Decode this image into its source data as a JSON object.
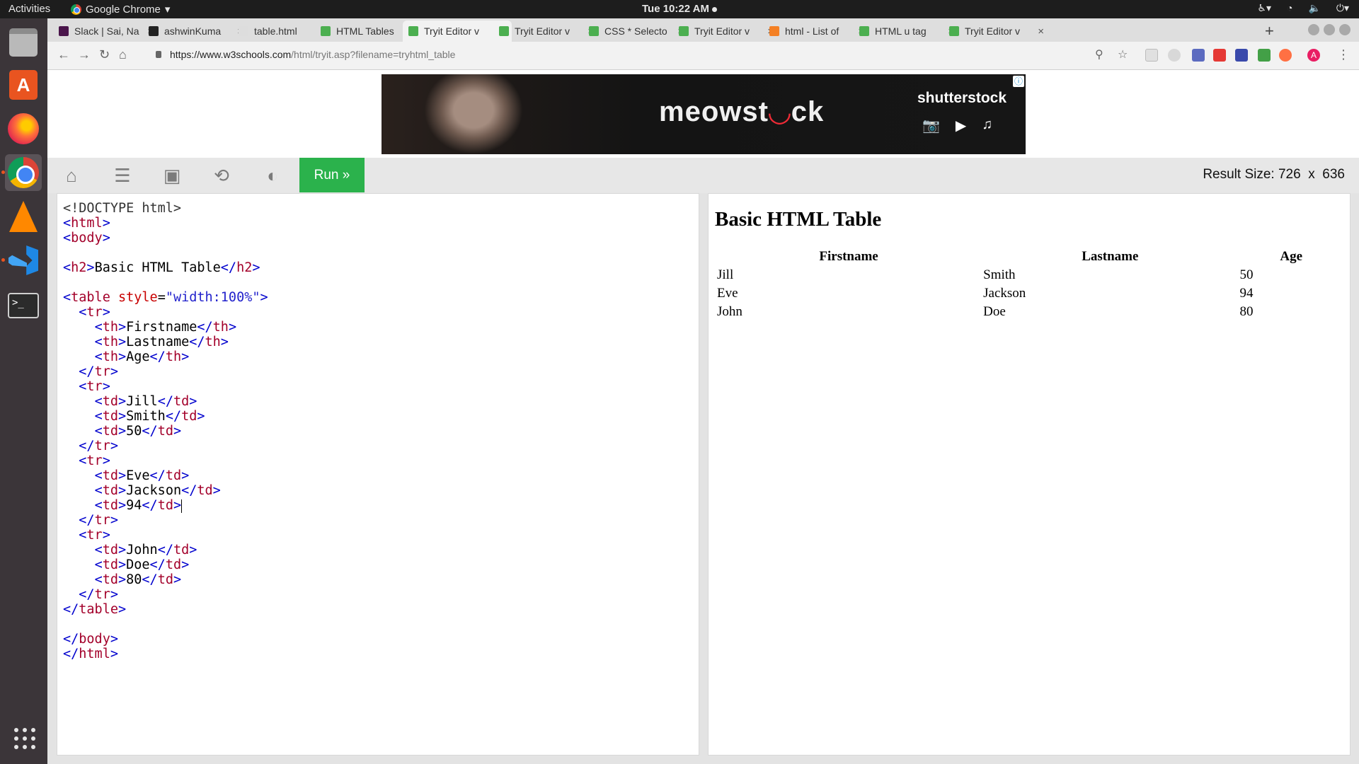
{
  "system": {
    "activities": "Activities",
    "app_menu": "Google Chrome",
    "clock": "Tue 10:22 AM"
  },
  "browser": {
    "tabs": [
      {
        "title": "Slack | Sai, Na",
        "favicon": "slack-icon",
        "color": "#4a154b"
      },
      {
        "title": "ashwinKuma",
        "favicon": "github-icon",
        "color": "#222222"
      },
      {
        "title": "table.html",
        "favicon": "file-icon",
        "color": "#dddddd"
      },
      {
        "title": "HTML Tables",
        "favicon": "w3schools-icon",
        "color": "#4caf50"
      },
      {
        "title": "Tryit Editor v",
        "favicon": "w3schools-icon",
        "color": "#4caf50",
        "active": true
      },
      {
        "title": "Tryit Editor v",
        "favicon": "w3schools-icon",
        "color": "#4caf50"
      },
      {
        "title": "CSS * Selecto",
        "favicon": "w3schools-icon",
        "color": "#4caf50"
      },
      {
        "title": "Tryit Editor v",
        "favicon": "w3schools-icon",
        "color": "#4caf50"
      },
      {
        "title": "html - List of",
        "favicon": "stackoverflow-icon",
        "color": "#f48024"
      },
      {
        "title": "HTML u tag",
        "favicon": "w3schools-icon",
        "color": "#4caf50"
      },
      {
        "title": "Tryit Editor v",
        "favicon": "w3schools-icon",
        "color": "#4caf50"
      }
    ],
    "url_host": "https://www.w3schools.com",
    "url_path": "/html/tryit.asp?filename=tryhtml_table"
  },
  "ad": {
    "brand_left": "meowst",
    "brand_mid": "",
    "brand_right": "ck",
    "sponsor": "shutterstock"
  },
  "editor": {
    "run_label": "Run »",
    "result_size_label": "Result Size:",
    "result_width": "726",
    "result_x": "x",
    "result_height": "636"
  },
  "result": {
    "heading": "Basic HTML Table",
    "headers": [
      "Firstname",
      "Lastname",
      "Age"
    ],
    "rows": [
      [
        "Jill",
        "Smith",
        "50"
      ],
      [
        "Eve",
        "Jackson",
        "94"
      ],
      [
        "John",
        "Doe",
        "80"
      ]
    ]
  },
  "colors": {
    "run_button": "#2bb24c",
    "tag": "#a3002a",
    "bracket": "#0000cd",
    "attr_name": "#c80000",
    "attr_value": "#2222cc"
  }
}
